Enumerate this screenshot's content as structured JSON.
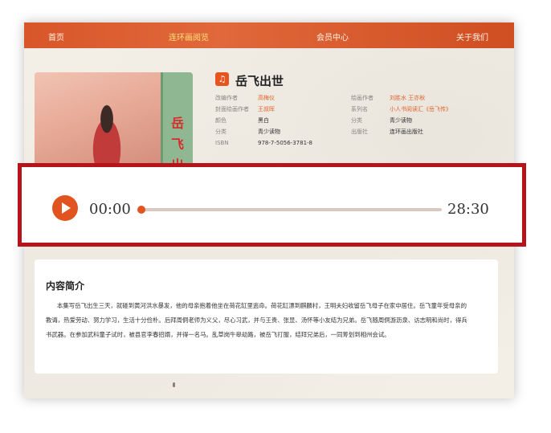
{
  "nav": {
    "items": [
      {
        "label": "首页",
        "active": false
      },
      {
        "label": "连环画阅览",
        "active": true
      },
      {
        "label": "会员中心",
        "active": false
      },
      {
        "label": "关于我们",
        "active": false
      }
    ]
  },
  "book": {
    "title": "岳飞出世",
    "cover_text": [
      "岳",
      "飞",
      "出"
    ],
    "meta_left": [
      {
        "key": "改编作者",
        "value": "高梅仪",
        "link": true
      },
      {
        "key": "封面绘画作者",
        "value": "王叔晖",
        "link": true
      },
      {
        "key": "颜色",
        "value": "黑白",
        "link": false
      },
      {
        "key": "分类",
        "value": "青少读物",
        "link": false
      },
      {
        "key": "ISBN",
        "value": "978-7-5056-3781-8",
        "link": false
      }
    ],
    "meta_right": [
      {
        "key": "绘画作者",
        "value": "刘胜水  王亦秋",
        "link": true
      },
      {
        "key": "系列名",
        "value": "小人书阅读汇《岳飞传》",
        "link": true
      },
      {
        "key": "分类",
        "value": "青少读物",
        "link": false
      },
      {
        "key": "出版社",
        "value": "连环画出版社",
        "link": false
      }
    ]
  },
  "player": {
    "current_time": "00:00",
    "total_time": "28:30",
    "progress": 0.0
  },
  "summary": {
    "title": "内容简介",
    "text": "本集写岳飞出生三天，就碰到黄河洪水暴发，他的母亲抱着他坐在荷花缸里逃命。荷花缸漂到麒麟村，王明夫妇收留岳飞母子在家中居住。岳飞童年受母亲的教诲，热爱劳动、努力学习，生活十分俭朴。后拜周侗老师为义父，尽心习武，并与王贵、张显、汤怀等小友结为兄弟。岳飞随周侗游沥泉、访志明和尚时，得兵书武器。在参加武科童子试时，被县官李春招婿，并得一名马。乱草岗牛皋劫路，被岳飞打服，结拜兄弟后，一同筹划到相州会试。"
  },
  "colors": {
    "accent": "#e1531f",
    "nav_bg": "#d8562a",
    "highlight_frame": "#b7131a"
  }
}
